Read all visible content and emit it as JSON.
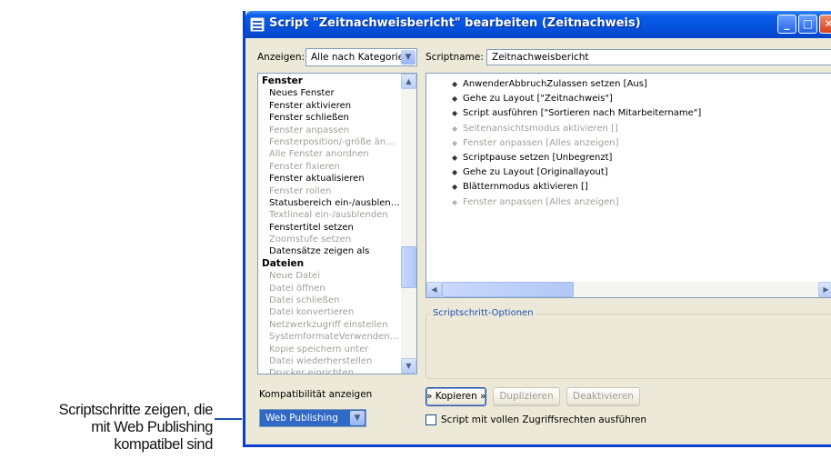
{
  "callout": {
    "line1": "Scriptschritte zeigen, die",
    "line2": "mit Web Publishing",
    "line3": "kompatibel sind"
  },
  "window": {
    "title": "Script \"Zeitnachweisbericht\" bearbeiten (Zeitnachweis)",
    "minimize_symbol": "_",
    "maximize_symbol": "□",
    "close_symbol": "✕"
  },
  "show": {
    "label": "Anzeigen:",
    "selected": "Alle nach Kategorie"
  },
  "scriptname": {
    "label": "Scriptname:",
    "value": "Zeitnachweisbericht"
  },
  "categories": [
    {
      "text": "Fenster",
      "kind": "header"
    },
    {
      "text": "Neues Fenster",
      "kind": "enabled"
    },
    {
      "text": "Fenster aktivieren",
      "kind": "enabled"
    },
    {
      "text": "Fenster schließen",
      "kind": "enabled"
    },
    {
      "text": "Fenster anpassen",
      "kind": "disabled"
    },
    {
      "text": "Fensterposition/-größe änd…",
      "kind": "disabled"
    },
    {
      "text": "Alle Fenster anordnen",
      "kind": "disabled"
    },
    {
      "text": "Fenster fixieren",
      "kind": "disabled"
    },
    {
      "text": "Fenster aktualisieren",
      "kind": "enabled"
    },
    {
      "text": "Fenster rollen",
      "kind": "disabled"
    },
    {
      "text": "Statusbereich ein-/ausblen…",
      "kind": "enabled"
    },
    {
      "text": "Textlineal ein-/ausblenden",
      "kind": "disabled"
    },
    {
      "text": "Fenstertitel setzen",
      "kind": "enabled"
    },
    {
      "text": "Zoomstufe setzen",
      "kind": "disabled"
    },
    {
      "text": "Datensätze zeigen als",
      "kind": "enabled"
    },
    {
      "text": "Dateien",
      "kind": "header"
    },
    {
      "text": "Neue Datei",
      "kind": "disabled"
    },
    {
      "text": "Datei öffnen",
      "kind": "disabled"
    },
    {
      "text": "Datei schließen",
      "kind": "disabled"
    },
    {
      "text": "Datei konvertieren",
      "kind": "disabled"
    },
    {
      "text": "Netzwerkzugriff einstellen",
      "kind": "disabled"
    },
    {
      "text": "SystemformateVerwenden …",
      "kind": "disabled"
    },
    {
      "text": "Kopie speichern unter",
      "kind": "disabled"
    },
    {
      "text": "Datei wiederherstellen",
      "kind": "disabled"
    },
    {
      "text": "Drucker einrichten",
      "kind": "disabled"
    }
  ],
  "script_steps": [
    {
      "text": "AnwenderAbbruchZulassen setzen [Aus]",
      "enabled": true
    },
    {
      "text": "Gehe zu Layout [\"Zeitnachweis\"]",
      "enabled": true
    },
    {
      "text": "Script ausführen [\"Sortieren nach Mitarbeitername\"]",
      "enabled": true
    },
    {
      "text": "Seitenansichtsmodus aktivieren []",
      "enabled": false
    },
    {
      "text": "Fenster anpassen [Alles anzeigen]",
      "enabled": false
    },
    {
      "text": "Scriptpause setzen [Unbegrenzt]",
      "enabled": true
    },
    {
      "text": "Gehe zu Layout [Originallayout]",
      "enabled": true
    },
    {
      "text": "Blätternmodus aktivieren []",
      "enabled": true
    },
    {
      "text": "Fenster anpassen [Alles anzeigen]",
      "enabled": false
    }
  ],
  "options": {
    "title": "Scriptschritt-Optionen"
  },
  "compat": {
    "label": "Kompatibilität anzeigen",
    "selected": "Web Publishing"
  },
  "buttons": {
    "copy": "» Kopieren »",
    "duplicate": "Duplizieren",
    "deactivate": "Deaktivieren"
  },
  "full_access": {
    "label": "Script mit vollen Zugriffsrechten ausführen",
    "checked": false
  },
  "colors": {
    "title_bar": "#0554e0",
    "selection": "#3169c6",
    "disabled_text": "#a09f98",
    "callout_line": "#1d4fae"
  }
}
